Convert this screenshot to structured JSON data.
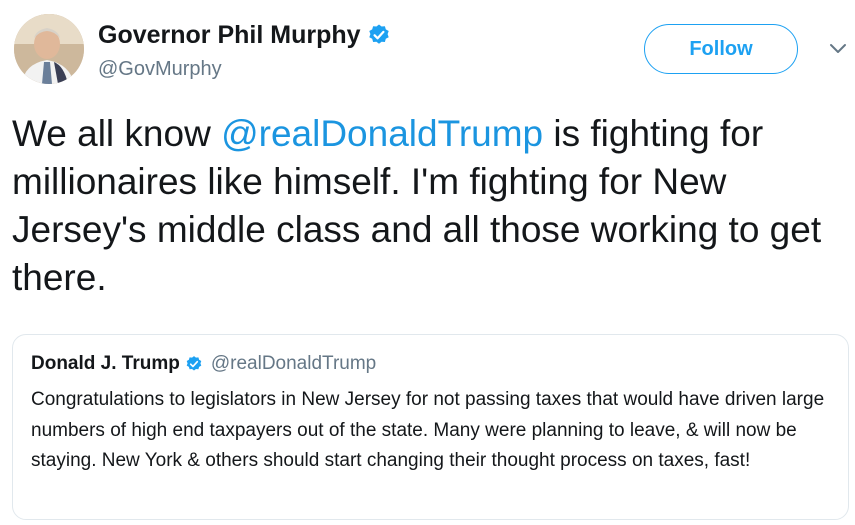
{
  "author": {
    "name": "Governor Phil Murphy",
    "handle": "@GovMurphy"
  },
  "follow_button": {
    "label": "Follow"
  },
  "tweet": {
    "text_before": "We all know ",
    "mention": "@realDonaldTrump",
    "text_after": " is fighting for millionaires like himself. I'm fighting for New Jersey's middle class and all those working to get there."
  },
  "quoted_tweet": {
    "name": "Donald J. Trump",
    "handle": "@realDonaldTrump",
    "text": "Congratulations to legislators in New Jersey for not passing taxes that would have driven large numbers of high end taxpayers out of the state. Many were planning to leave, & will now be staying. New York & others should start changing their thought process on taxes, fast!"
  },
  "colors": {
    "accent": "#1da1f2",
    "mention": "#1b95e0",
    "secondary_text": "#657786",
    "border": "#e1e8ed"
  },
  "icons": {
    "verified": "verified-badge-icon",
    "caret": "chevron-down-icon"
  }
}
